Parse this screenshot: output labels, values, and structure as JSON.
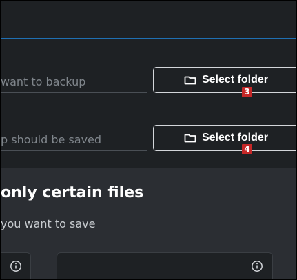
{
  "header": {},
  "backup": {
    "source_placeholder": "want to backup",
    "destination_placeholder": "p should be saved",
    "source_button_label": "Select folder",
    "destination_button_label": "Select folder",
    "source_badge": "3",
    "destination_badge": "4"
  },
  "filters": {
    "title": "only certain files",
    "subtitle": "you want to save"
  },
  "icons": {
    "folder": "folder-icon",
    "info": "info-icon"
  },
  "colors": {
    "accent_line": "#1f6fb2",
    "badge": "#c62828",
    "background_top": "#1e2124",
    "background_bottom": "#2b2e33"
  }
}
